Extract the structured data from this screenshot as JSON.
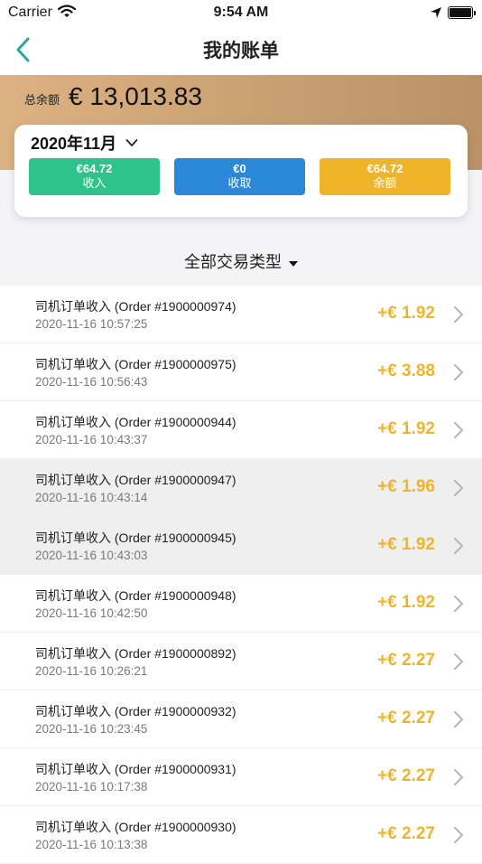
{
  "status_bar": {
    "carrier": "Carrier",
    "time": "9:54 AM"
  },
  "nav": {
    "title": "我的账单"
  },
  "balance": {
    "label": "总余额",
    "amount": "€ 13,013.83"
  },
  "summary": {
    "month": "2020年11月",
    "income": {
      "value": "€64.72",
      "label": "收入"
    },
    "collected": {
      "value": "€0",
      "label": "收取"
    },
    "balance": {
      "value": "€64.72",
      "label": "余额"
    }
  },
  "filter": {
    "label": "全部交易类型"
  },
  "transactions": [
    {
      "title": "司机订单收入 (Order #1900000974)",
      "date": "2020-11-16 10:57:25",
      "amount": "+€ 1.92"
    },
    {
      "title": "司机订单收入 (Order #1900000975)",
      "date": "2020-11-16 10:56:43",
      "amount": "+€ 3.88"
    },
    {
      "title": "司机订单收入 (Order #1900000944)",
      "date": "2020-11-16 10:43:37",
      "amount": "+€ 1.92"
    },
    {
      "title": "司机订单收入 (Order #1900000947)",
      "date": "2020-11-16 10:43:14",
      "amount": "+€ 1.96"
    },
    {
      "title": "司机订单收入 (Order #1900000945)",
      "date": "2020-11-16 10:43:03",
      "amount": "+€ 1.92"
    },
    {
      "title": "司机订单收入 (Order #1900000948)",
      "date": "2020-11-16 10:42:50",
      "amount": "+€ 1.92"
    },
    {
      "title": "司机订单收入 (Order #1900000892)",
      "date": "2020-11-16 10:26:21",
      "amount": "+€ 2.27"
    },
    {
      "title": "司机订单收入 (Order #1900000932)",
      "date": "2020-11-16 10:23:45",
      "amount": "+€ 2.27"
    },
    {
      "title": "司机订单收入 (Order #1900000931)",
      "date": "2020-11-16 10:17:38",
      "amount": "+€ 2.27"
    },
    {
      "title": "司机订单收入 (Order #1900000930)",
      "date": "2020-11-16 10:13:38",
      "amount": "+€ 2.27"
    }
  ],
  "colors": {
    "accent_teal": "#2aa6a9",
    "income_green": "#2ec38b",
    "collect_blue": "#2b87d8",
    "balance_yellow": "#efb429",
    "banner_gold": "#c9a071"
  },
  "icons": {
    "back": "chevron-left-icon",
    "month_dropdown": "chevron-down-icon",
    "filter_dropdown": "caret-down-icon",
    "row_arrow": "chevron-right-icon"
  }
}
